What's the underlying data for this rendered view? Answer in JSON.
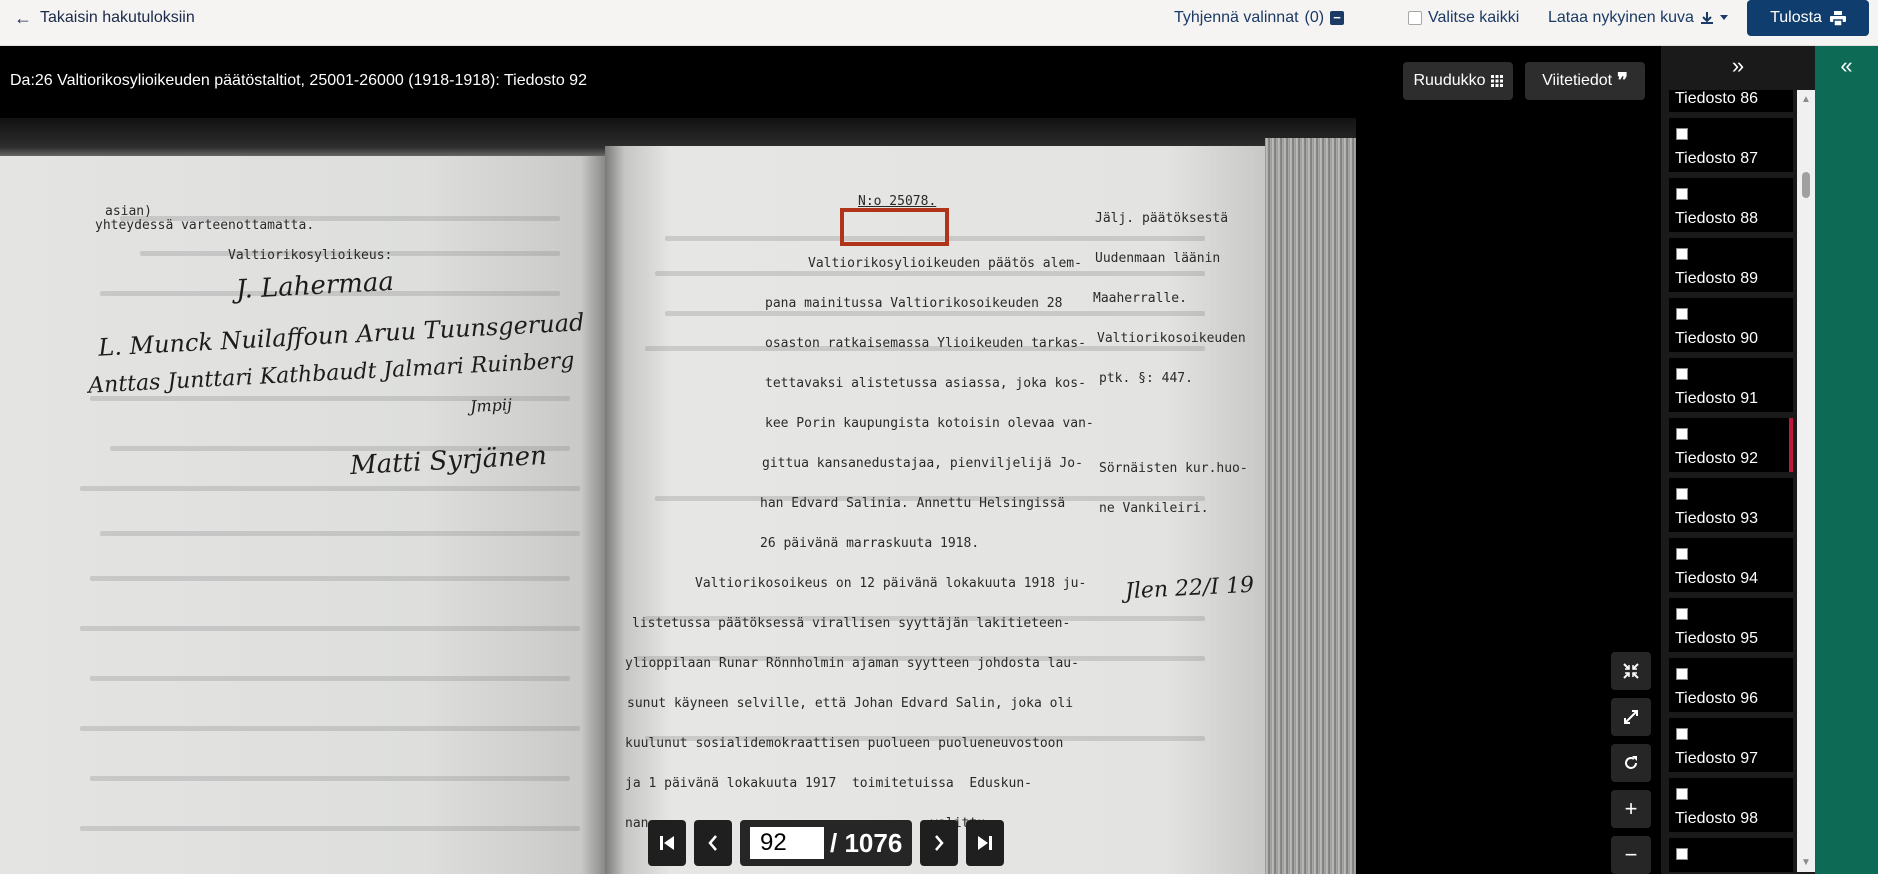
{
  "topbar": {
    "back_label": "Takaisin hakutuloksiin",
    "clear_label": "Tyhjennä valinnat",
    "clear_count": "(0)",
    "select_all_label": "Valitse kaikki",
    "download_label": "Lataa nykyinen kuva",
    "print_label": "Tulosta"
  },
  "document": {
    "title": "Da:26 Valtiorikosylioikeuden päätöstaltiot, 25001-26000 (1918-1918): Tiedosto 92",
    "grid_label": "Ruudukko",
    "citation_label": "Viitetiedot"
  },
  "scan": {
    "left_page": {
      "typed_lines": [
        "asian)",
        "yhteydessä varteenottamatta.",
        "Valtiorikosylioikeus:"
      ],
      "signatures": [
        "J. Lahermaa",
        "L. Munck  Nuilaffoun  Aruu Tuunsgeruad",
        "Anttas Junttari  Kathbaudt  Jalmari Ruinberg",
        "Jmpij",
        "Matti Syrjänen"
      ]
    },
    "right_page": {
      "number": "N:o 25078.",
      "body_lines": [
        "Valtiorikosylioikeuden päätös alem-",
        "pana mainitussa Valtiorikosoikeuden 28",
        "osaston ratkaisemassa Ylioikeuden tarkas-",
        "tettavaksi alistetussa asiassa, joka kos-",
        "kee Porin kaupungista kotoisin olevaa van-",
        "gittua kansanedustajaa, pienviljelijä Jo-",
        "han Edvard Salinia. Annettu Helsingissä",
        "26 päivänä marraskuuta 1918.",
        "Valtiorikosoikeus on 12 päivänä lokakuuta 1918 ju-",
        "listetussa päätöksessä virallisen syyttäjän lakitieteen-",
        "ylioppilaan Runar Rönnholmin ajaman syytteen johdosta lau-",
        "sunut käyneen selville, että Johan Edvard Salin, joka oli",
        "kuulunut sosialidemokraattisen puolueen puolueneuvostoon",
        "ja 1 päivänä lokakuuta 1917  toimitetuissa  Eduskun-",
        "nan                                    valittu"
      ],
      "margin_lines": [
        "Jälj. päätöksestä",
        "Uudenmaan läänin",
        "Maaherralle.",
        "Valtiorikosoikeuden",
        "ptk. §: 447.",
        "Sörnäisten kur.huo-",
        "ne Vankileiri."
      ],
      "margin_note": "Jlen 22/I 19"
    }
  },
  "pager": {
    "current_page": "92",
    "total_label": "/ 1076"
  },
  "thumbnails": {
    "items": [
      {
        "label": "Tiedosto 86"
      },
      {
        "label": "Tiedosto 87"
      },
      {
        "label": "Tiedosto 88"
      },
      {
        "label": "Tiedosto 89"
      },
      {
        "label": "Tiedosto 90"
      },
      {
        "label": "Tiedosto 91"
      },
      {
        "label": "Tiedosto 92",
        "active": true
      },
      {
        "label": "Tiedosto 93"
      },
      {
        "label": "Tiedosto 94"
      },
      {
        "label": "Tiedosto 95"
      },
      {
        "label": "Tiedosto 96"
      },
      {
        "label": "Tiedosto 97"
      },
      {
        "label": "Tiedosto 98"
      }
    ]
  },
  "icons": {
    "back": "arrow-left-icon",
    "clear": "minus-square-icon",
    "download": "download-icon",
    "print": "printer-icon",
    "grid": "grid-icon",
    "citation": "quote-icon",
    "collapse_thumbs": "chevrons-right-icon",
    "expand_panel": "chevrons-left-icon"
  },
  "colors": {
    "print_button": "#0e3d6e",
    "side_strip": "#0c6a55",
    "active_thumb_marker": "#c0183b",
    "highlight_box": "#b0341a"
  }
}
